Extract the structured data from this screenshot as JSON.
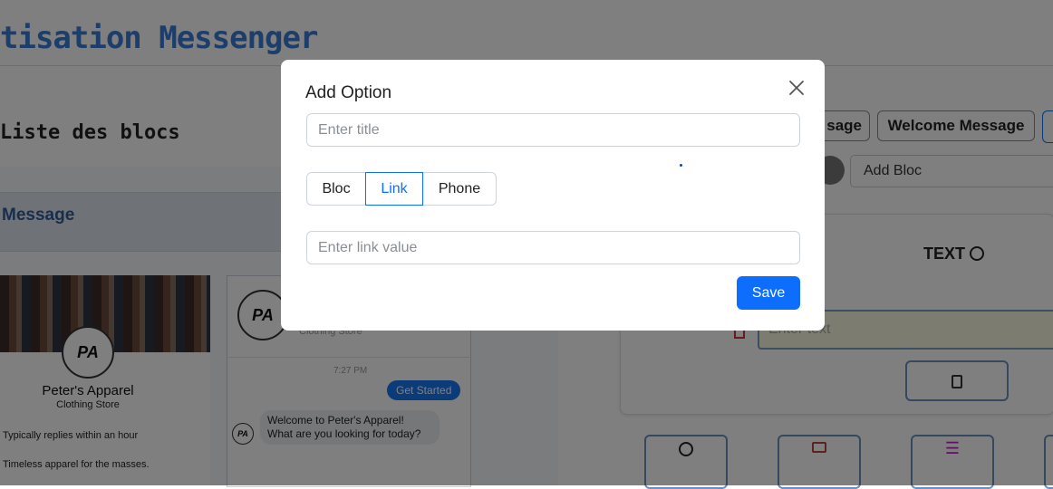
{
  "app": {
    "title": "tisation Messenger",
    "blocks_heading": "Liste des blocs",
    "message_header": "Message"
  },
  "preview": {
    "page_name": "Peter's Apparel",
    "page_category": "Clothing Store",
    "page_category_partial": "Clothing Store",
    "reply_time": "Typically replies within an hour",
    "tagline": "Timeless apparel for the masses.",
    "logo_text": "PA",
    "time": "7:27 PM",
    "get_started": "Get Started",
    "bot_message": "Welcome to Peter's Apparel! What are you looking for today?"
  },
  "right": {
    "btn_partial": "sage",
    "btn_welcome": "Welcome Message",
    "add_bloc": "Add Bloc",
    "text_label": "TEXT",
    "enter_text_placeholder": "Enter text"
  },
  "modal": {
    "title": "Add Option",
    "title_placeholder": "Enter title",
    "title_value": "",
    "tabs": [
      "Bloc",
      "Link",
      "Phone"
    ],
    "active_tab": "Link",
    "link_placeholder": "Enter link value",
    "link_value": "",
    "save_label": "Save"
  },
  "colors": {
    "primary": "#0d6efd",
    "title_blue": "#3a7bd5",
    "overlay": "rgba(0,0,0,0.5)"
  }
}
